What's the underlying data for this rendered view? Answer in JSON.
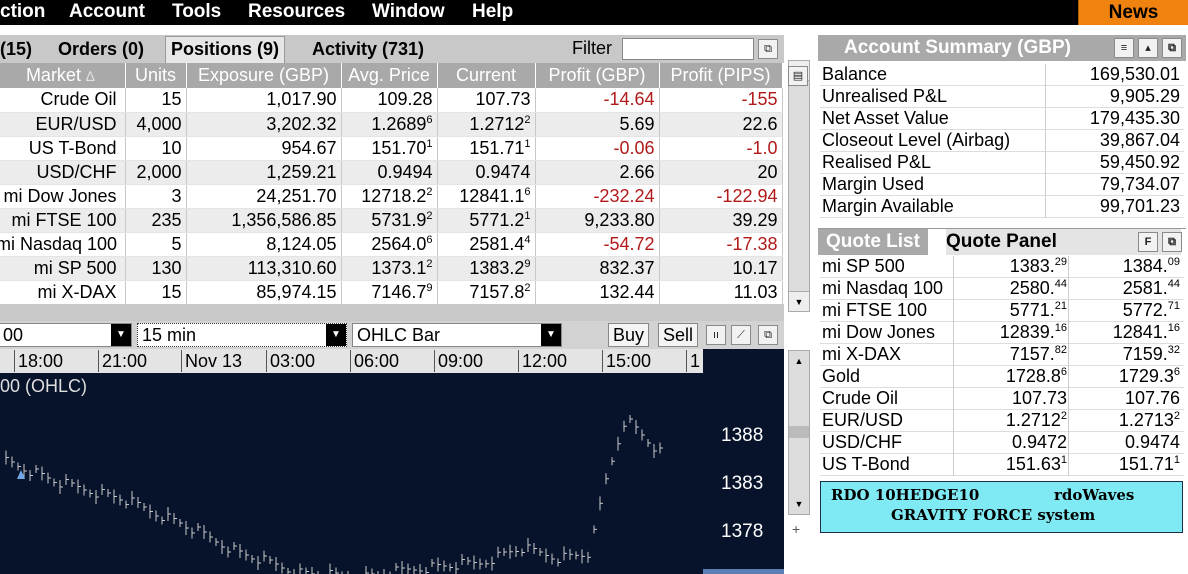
{
  "menu": {
    "items": [
      "ction",
      "Account",
      "Tools",
      "Resources",
      "Window",
      "Help"
    ],
    "news": "News"
  },
  "tabs": {
    "t0": "(15)",
    "t1": "Orders (0)",
    "t2": "Positions (9)",
    "t3": "Activity (731)"
  },
  "filter": {
    "label": "Filter",
    "value": ""
  },
  "positions": {
    "headers": [
      "Market",
      "Units",
      "Exposure (GBP)",
      "Avg. Price",
      "Current",
      "Profit (GBP)",
      "Profit (PIPS)"
    ],
    "sort_indicator": "∆",
    "rows": [
      {
        "market": "Crude Oil",
        "units": "15",
        "exposure": "1,017.90",
        "avg_main": "109.28",
        "avg_sup": "",
        "cur_main": "107.73",
        "cur_sup": "",
        "profit": "-14.64",
        "pips": "-155",
        "neg": true
      },
      {
        "market": "EUR/USD",
        "units": "4,000",
        "exposure": "3,202.32",
        "avg_main": "1.2689",
        "avg_sup": "6",
        "cur_main": "1.2712",
        "cur_sup": "2",
        "profit": "5.69",
        "pips": "22.6",
        "neg": false
      },
      {
        "market": "US T-Bond",
        "units": "10",
        "exposure": "954.67",
        "avg_main": "151.70",
        "avg_sup": "1",
        "cur_main": "151.71",
        "cur_sup": "1",
        "profit": "-0.06",
        "pips": "-1.0",
        "neg": true
      },
      {
        "market": "USD/CHF",
        "units": "2,000",
        "exposure": "1,259.21",
        "avg_main": "0.9494",
        "avg_sup": "",
        "cur_main": "0.9474",
        "cur_sup": "",
        "profit": "2.66",
        "pips": "20",
        "neg": false
      },
      {
        "market": "mi Dow Jones",
        "units": "3",
        "exposure": "24,251.70",
        "avg_main": "12718.2",
        "avg_sup": "2",
        "cur_main": "12841.1",
        "cur_sup": "6",
        "profit": "-232.24",
        "pips": "-122.94",
        "neg": true
      },
      {
        "market": "mi FTSE 100",
        "units": "235",
        "exposure": "1,356,586.85",
        "avg_main": "5731.9",
        "avg_sup": "2",
        "cur_main": "5771.2",
        "cur_sup": "1",
        "profit": "9,233.80",
        "pips": "39.29",
        "neg": false
      },
      {
        "market": "mi Nasdaq 100",
        "units": "5",
        "exposure": "8,124.05",
        "avg_main": "2564.0",
        "avg_sup": "6",
        "cur_main": "2581.4",
        "cur_sup": "4",
        "profit": "-54.72",
        "pips": "-17.38",
        "neg": true
      },
      {
        "market": "mi SP 500",
        "units": "130",
        "exposure": "113,310.60",
        "avg_main": "1373.1",
        "avg_sup": "2",
        "cur_main": "1383.2",
        "cur_sup": "9",
        "profit": "832.37",
        "pips": "10.17",
        "neg": false
      },
      {
        "market": "mi X-DAX",
        "units": "15",
        "exposure": "85,974.15",
        "avg_main": "7146.7",
        "avg_sup": "9",
        "cur_main": "7157.8",
        "cur_sup": "2",
        "profit": "132.44",
        "pips": "11.03",
        "neg": false
      }
    ]
  },
  "chart_toolbar": {
    "instrument": "00",
    "interval": "15 min",
    "type": "OHLC Bar",
    "buy": "Buy",
    "sell": "Sell"
  },
  "chart": {
    "title": "00 (OHLC)",
    "time_labels": [
      "18:00",
      "21:00",
      "Nov 13",
      "03:00",
      "06:00",
      "09:00",
      "12:00",
      "15:00",
      "1"
    ],
    "y_labels": [
      "1388",
      "1383",
      "1378"
    ],
    "bg_color": "#07132b",
    "bar_color": "#c8c8c8"
  },
  "account": {
    "title": "Account Summary (GBP)",
    "rows": [
      {
        "label": "Balance",
        "value": "169,530.01"
      },
      {
        "label": "Unrealised P&L",
        "value": "9,905.29"
      },
      {
        "label": "Net Asset Value",
        "value": "179,435.30"
      },
      {
        "label": "Closeout Level (Airbag)",
        "value": "39,867.04"
      },
      {
        "label": "Realised P&L",
        "value": "59,450.92"
      },
      {
        "label": "Margin Used",
        "value": "79,734.07"
      },
      {
        "label": "Margin Available",
        "value": "99,701.23"
      }
    ]
  },
  "quotes": {
    "tab_list": "Quote List",
    "tab_panel": "Quote Panel",
    "rows": [
      {
        "name": "mi SP 500",
        "bid": "1383.",
        "bid_sup": "29",
        "ask": "1384.",
        "ask_sup": "09"
      },
      {
        "name": "mi Nasdaq 100",
        "bid": "2580.",
        "bid_sup": "44",
        "ask": "2581.",
        "ask_sup": "44"
      },
      {
        "name": "mi FTSE 100",
        "bid": "5771.",
        "bid_sup": "21",
        "ask": "5772.",
        "ask_sup": "71"
      },
      {
        "name": "mi Dow Jones",
        "bid": "12839.",
        "bid_sup": "16",
        "ask": "12841.",
        "ask_sup": "16"
      },
      {
        "name": "mi X-DAX",
        "bid": "7157.",
        "bid_sup": "82",
        "ask": "7159.",
        "ask_sup": "32"
      },
      {
        "name": "Gold",
        "bid": "1728.8",
        "bid_sup": "6",
        "ask": "1729.3",
        "ask_sup": "6"
      },
      {
        "name": "Crude Oil",
        "bid": "107.73",
        "bid_sup": "",
        "ask": "107.76",
        "ask_sup": ""
      },
      {
        "name": "EUR/USD",
        "bid": "1.2712",
        "bid_sup": "2",
        "ask": "1.2713",
        "ask_sup": "2"
      },
      {
        "name": "USD/CHF",
        "bid": "0.9472",
        "bid_sup": "",
        "ask": "0.9474",
        "ask_sup": ""
      },
      {
        "name": "US T-Bond",
        "bid": "151.63",
        "bid_sup": "1",
        "ask": "151.71",
        "ask_sup": "1"
      }
    ]
  },
  "promo": {
    "line1a": "RDO  10HEDGE10",
    "line1b": "rdoWaves",
    "line2": "GRAVITY  FORCE system",
    "bg": "#7feaf3"
  }
}
